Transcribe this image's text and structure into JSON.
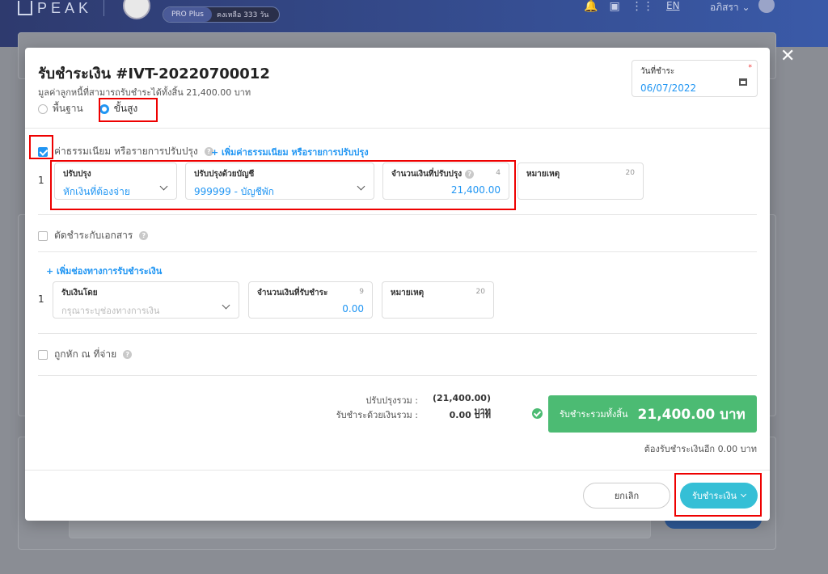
{
  "topbar": {
    "logo": "PEAK",
    "plan_name": "PRO Plus",
    "plan_remaining": "คงเหลือ 333 วัน",
    "lang": "EN",
    "user": "อภิสรา"
  },
  "modal": {
    "title": "รับชำระเงิน #IVT-20220700012",
    "subtitle": "มูลค่าลูกหนี้ที่สามารถรับชำระได้ทั้งสิ้น 21,400.00 บาท",
    "mode_basic": "พื้นฐาน",
    "mode_advanced": "ขั้นสูง",
    "mode_selected": "ขั้นสูง",
    "date": {
      "label": "วันที่ชำระ",
      "value": "06/07/2022",
      "required": "*"
    },
    "fees": {
      "label": "ค่าธรรมเนียม หรือรายการปรับปรุง",
      "add_link": "+ เพิ่มค่าธรรมเนียม หรือรายการปรับปรุง",
      "checked": true,
      "row": {
        "num": "1",
        "adjust_label": "ปรับปรุง",
        "adjust_value": "หักเงินที่ต้องจ่าย",
        "account_label": "ปรับปรุงด้วยบัญชี",
        "account_value": "999999 - บัญชีพัก",
        "amount_label": "จำนวนเงินที่ปรับปรุง",
        "amount_count": "4",
        "amount_value": "21,400.00",
        "note_label": "หมายเหตุ",
        "note_count": "20"
      }
    },
    "offset": {
      "label": "ตัดชำระกับเอกสาร",
      "checked": false
    },
    "payment": {
      "add_link": "+ เพิ่มช่องทางการรับชำระเงิน",
      "row": {
        "num": "1",
        "method_label": "รับเงินโดย",
        "method_placeholder": "กรุณาระบุช่องทางการเงิน",
        "amount_label": "จำนวนเงินที่รับชำระ",
        "amount_count": "9",
        "amount_value": "0.00",
        "note_label": "หมายเหตุ",
        "note_count": "20"
      }
    },
    "withholding": {
      "label": "ถูกหัก ณ ที่จ่าย",
      "checked": false
    },
    "summary": {
      "adjust_label": "ปรับปรุงรวม :",
      "adjust_value": "(21,400.00) บาท",
      "cash_label": "รับชำระด้วยเงินรวม :",
      "cash_value": "0.00 บาท",
      "total_label": "รับชำระรวมทั้งสิ้น",
      "total_value": "21,400.00 บาท",
      "remaining": "ต้องรับชำระเงินอีก 0.00 บาท"
    },
    "buttons": {
      "cancel": "ยกเลิก",
      "pay": "รับชำระเงิน"
    },
    "close": "✕"
  },
  "colors": {
    "accent": "#2196f3",
    "success": "#4cbb73",
    "pay_button": "#35bfd6",
    "highlight": "#e00000"
  }
}
